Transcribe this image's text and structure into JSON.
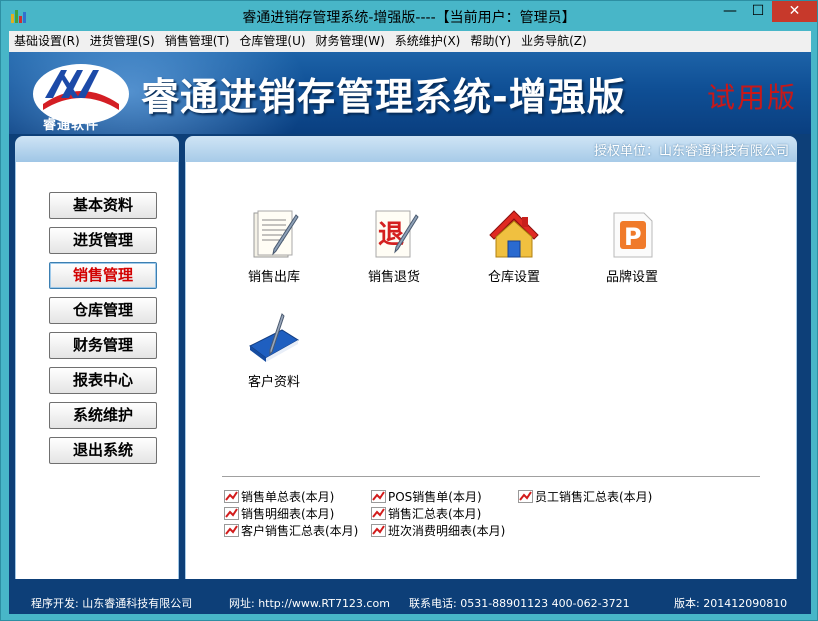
{
  "window": {
    "title": "睿通进销存管理系统-增强版----【当前用户：管理员】",
    "min": "—",
    "max": "☐",
    "close": "✕"
  },
  "menu": [
    "基础设置(R)",
    "进货管理(S)",
    "销售管理(T)",
    "仓库管理(U)",
    "财务管理(W)",
    "系统维护(X)",
    "帮助(Y)",
    "业务导航(Z)"
  ],
  "banner": {
    "logo_caption": "睿通软件",
    "title": "睿通进销存管理系统-增强版",
    "trial": "试用版"
  },
  "header": {
    "authorized": "授权单位：山东睿通科技有限公司"
  },
  "sidebar": {
    "active_index": 2,
    "items": [
      "基本资料",
      "进货管理",
      "销售管理",
      "仓库管理",
      "财务管理",
      "报表中心",
      "系统维护",
      "退出系统"
    ]
  },
  "tiles": [
    {
      "label": "销售出库",
      "icon": "document-pen-icon"
    },
    {
      "label": "销售退货",
      "icon": "return-document-icon",
      "glyph": "退"
    },
    {
      "label": "仓库设置",
      "icon": "warehouse-house-icon"
    },
    {
      "label": "品牌设置",
      "icon": "brand-p-icon",
      "glyph": "P"
    },
    {
      "label": "客户资料",
      "icon": "blue-book-pen-icon"
    }
  ],
  "reports": [
    "销售单总表(本月)",
    "POS销售单(本月)",
    "员工销售汇总表(本月)",
    "销售明细表(本月)",
    "销售汇总表(本月)",
    "客户销售汇总表(本月)",
    "班次消费明细表(本月)"
  ],
  "status": {
    "developer": "程序开发: 山东睿通科技有限公司",
    "website": "网址: http://www.RT7123.com",
    "phone": "联系电话: 0531-88901123 400-062-3721",
    "version": "版本: 201412090810"
  },
  "colors": {
    "window_frame": "#48b6c8",
    "banner_blue": "#0f4f95",
    "trial_red": "#c81818",
    "active_nav_red": "#d20000"
  }
}
